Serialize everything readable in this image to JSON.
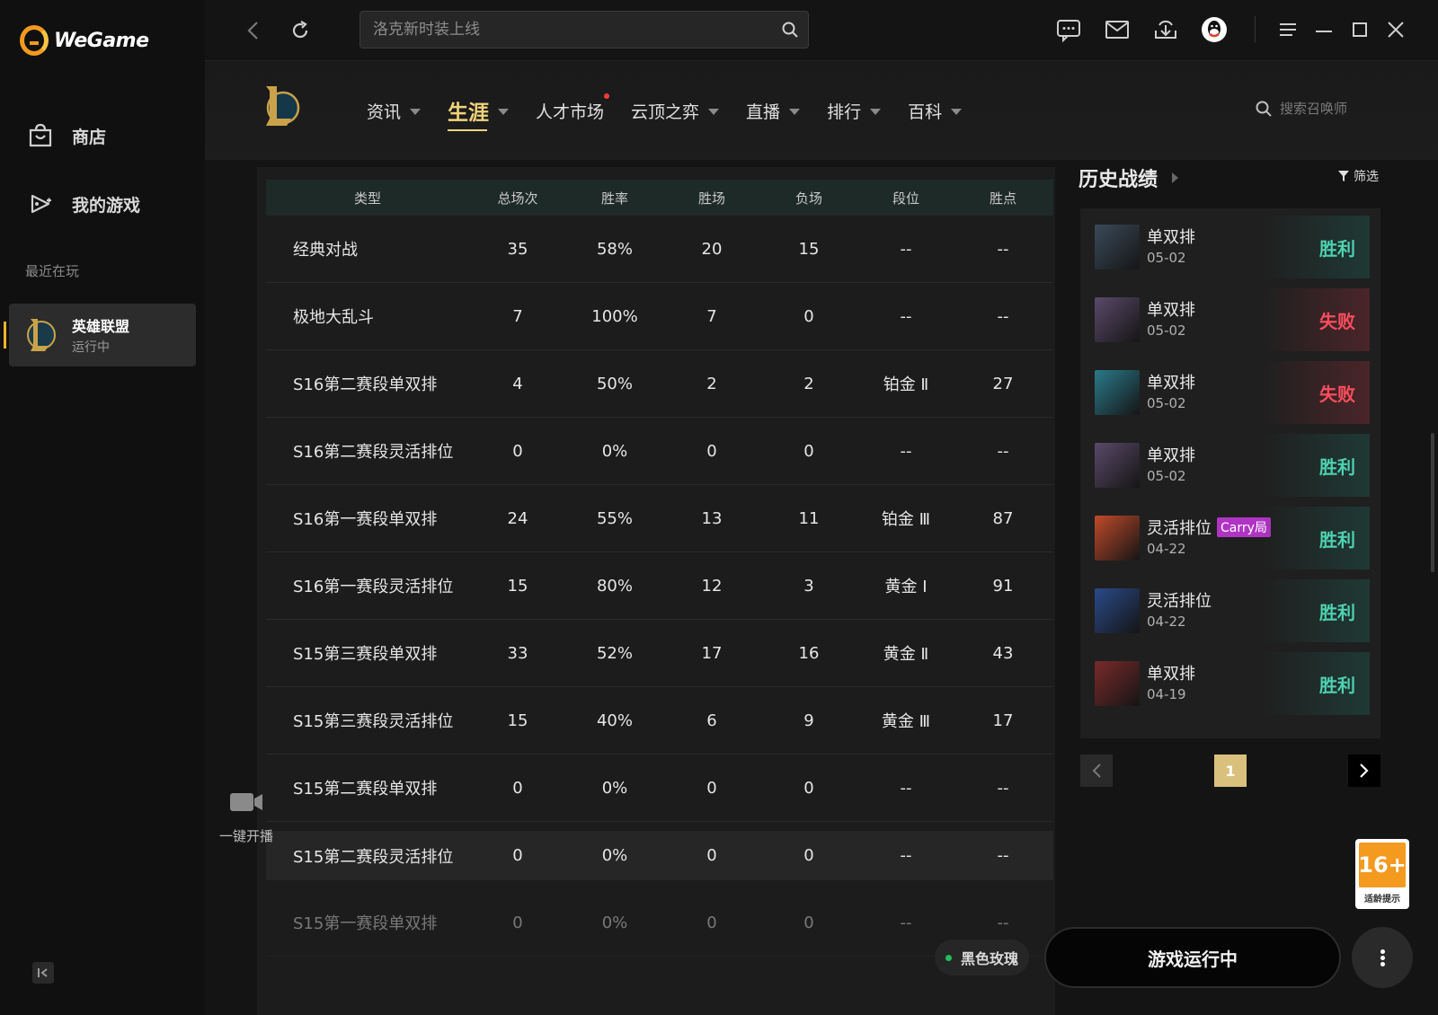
{
  "app": {
    "logo_text": "WeGame"
  },
  "sidebar": {
    "items": [
      {
        "label": "商店",
        "icon": "shop-icon"
      },
      {
        "label": "我的游戏",
        "icon": "gamepad-icon"
      }
    ],
    "recent_section": "最近在玩",
    "recent_game": {
      "name": "英雄联盟",
      "status": "运行中"
    }
  },
  "topbar": {
    "search_placeholder": "洛克新时装上线"
  },
  "game_nav": {
    "tabs": [
      {
        "label": "资讯",
        "caret": true
      },
      {
        "label": "生涯",
        "caret": true,
        "active": true
      },
      {
        "label": "人才市场",
        "dot": true
      },
      {
        "label": "云顶之弈",
        "caret": true
      },
      {
        "label": "直播",
        "caret": true
      },
      {
        "label": "排行",
        "caret": true
      },
      {
        "label": "百科",
        "caret": true
      }
    ],
    "summoner_search_placeholder": "搜索召唤师"
  },
  "stats_table": {
    "headers": [
      "类型",
      "总场次",
      "胜率",
      "胜场",
      "负场",
      "段位",
      "胜点"
    ],
    "rows": [
      [
        "经典对战",
        "35",
        "58%",
        "20",
        "15",
        "--",
        "--"
      ],
      [
        "极地大乱斗",
        "7",
        "100%",
        "7",
        "0",
        "--",
        "--"
      ],
      [
        "S16第二赛段单双排",
        "4",
        "50%",
        "2",
        "2",
        "铂金 Ⅱ",
        "27"
      ],
      [
        "S16第二赛段灵活排位",
        "0",
        "0%",
        "0",
        "0",
        "--",
        "--"
      ],
      [
        "S16第一赛段单双排",
        "24",
        "55%",
        "13",
        "11",
        "铂金 Ⅲ",
        "87"
      ],
      [
        "S16第一赛段灵活排位",
        "15",
        "80%",
        "12",
        "3",
        "黄金 Ⅰ",
        "91"
      ],
      [
        "S15第三赛段单双排",
        "33",
        "52%",
        "17",
        "16",
        "黄金 Ⅱ",
        "43"
      ],
      [
        "S15第三赛段灵活排位",
        "15",
        "40%",
        "6",
        "9",
        "黄金 Ⅲ",
        "17"
      ],
      [
        "S15第二赛段单双排",
        "0",
        "0%",
        "0",
        "0",
        "--",
        "--"
      ],
      [
        "S15第二赛段灵活排位",
        "0",
        "0%",
        "0",
        "0",
        "--",
        "--"
      ],
      [
        "S15第一赛段单双排",
        "0",
        "0%",
        "0",
        "0",
        "--",
        "--"
      ]
    ]
  },
  "history": {
    "title": "历史战绩",
    "filter_label": "筛选",
    "matches": [
      {
        "mode": "单双排",
        "date": "05-02",
        "result": "胜利",
        "win": true,
        "color": "#3a4a5a"
      },
      {
        "mode": "单双排",
        "date": "05-02",
        "result": "失败",
        "win": false,
        "color": "#5a4a6a"
      },
      {
        "mode": "单双排",
        "date": "05-02",
        "result": "失败",
        "win": false,
        "color": "#2a7a8a"
      },
      {
        "mode": "单双排",
        "date": "05-02",
        "result": "胜利",
        "win": true,
        "color": "#5a4a6a"
      },
      {
        "mode": "灵活排位",
        "date": "04-22",
        "result": "胜利",
        "win": true,
        "badge": "Carry局",
        "color": "#c04a2a"
      },
      {
        "mode": "灵活排位",
        "date": "04-22",
        "result": "胜利",
        "win": true,
        "color": "#2a4a8a"
      },
      {
        "mode": "单双排",
        "date": "04-19",
        "result": "胜利",
        "win": true,
        "color": "#7a2a2a"
      }
    ],
    "page": "1"
  },
  "bottom": {
    "stream_label": "一键开播",
    "age_rating": "16+",
    "age_sub": "适龄提示",
    "server": "黑色玫瑰",
    "play_label": "游戏运行中"
  }
}
